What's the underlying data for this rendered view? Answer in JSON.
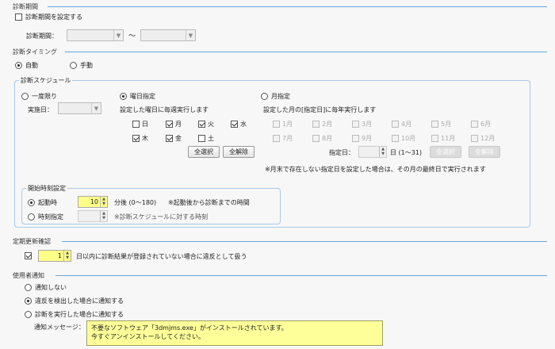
{
  "period": {
    "section_title": "診断期間",
    "checkbox_label": "診断期間を設定する",
    "field_label": "診断期間：",
    "range_separator": "～"
  },
  "timing": {
    "section_title": "診断タイミング",
    "auto_label": "自動",
    "manual_label": "手動",
    "selected": "auto"
  },
  "schedule": {
    "group_title": "診断スケジュール",
    "once_label": "一度限り",
    "run_date_label": "実施日：",
    "weekday_label": "曜日指定",
    "weekday_desc": "設定した曜日に毎週実行します",
    "days": [
      {
        "label": "日",
        "checked": false
      },
      {
        "label": "月",
        "checked": true
      },
      {
        "label": "火",
        "checked": true
      },
      {
        "label": "水",
        "checked": true
      },
      {
        "label": "木",
        "checked": true
      },
      {
        "label": "金",
        "checked": true
      },
      {
        "label": "土",
        "checked": false
      }
    ],
    "select_all": "全選択",
    "deselect_all": "全解除",
    "monthly_label": "月指定",
    "monthly_desc": "設定した月の[指定日]に毎年実行します",
    "months": [
      "1月",
      "2月",
      "3月",
      "4月",
      "5月",
      "6月",
      "7月",
      "8月",
      "9月",
      "10月",
      "11月",
      "12月"
    ],
    "day_label": "指定日：",
    "day_unit": "日 (1～31)",
    "month_note": "※月末で存在しない指定日を設定した場合は、その月の最終日で実行されます"
  },
  "start": {
    "group_title": "開始時刻設定",
    "on_boot_label": "起動時",
    "minutes_value": "10",
    "minutes_unit": "分後 (0～180)",
    "on_boot_note": "※起動後から診断までの時間",
    "time_label": "時刻指定",
    "time_note": "※診断スケジュールに対する時刻"
  },
  "periodic": {
    "section_title": "定期更新確認",
    "days_value": "1",
    "desc": "日以内に診断結果が登録されていない場合に違反として扱う"
  },
  "notify": {
    "section_title": "使用者通知",
    "options": [
      "通知しない",
      "違反を検出した場合に通知する",
      "診断を実行した場合に通知する"
    ],
    "selected_index": 1,
    "message_label": "通知メッセージ：",
    "message_line1": "不要なソフトウェア「3dmjms.exe」がインストールされています。",
    "message_line2": "今すぐアンインストールしてください。"
  }
}
